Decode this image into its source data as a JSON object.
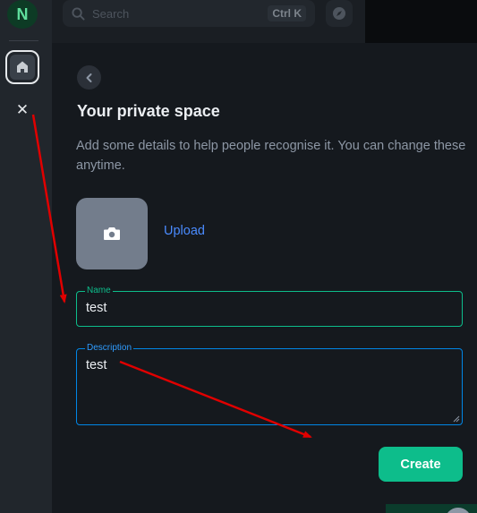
{
  "space_rail": {
    "avatar_letter": "N",
    "home_icon": "home-icon",
    "close_symbol": "✕"
  },
  "room_list": {
    "search_placeholder": "Search",
    "search_shortcut": "Ctrl K",
    "explore_icon": "compass-icon"
  },
  "dialog": {
    "title": "Your private space",
    "description": "Add some details to help people recognise it. You can change these anytime.",
    "upload_label": "Upload",
    "name_field": {
      "label": "Name",
      "value": "test"
    },
    "description_field": {
      "label": "Description",
      "value": "test"
    },
    "create_label": "Create"
  },
  "colors": {
    "accent_green": "#0dbd8b",
    "link_blue": "#4a8bff",
    "focus_blue": "#0086e6",
    "annotation_red": "#e00000",
    "background": "#15191e"
  }
}
